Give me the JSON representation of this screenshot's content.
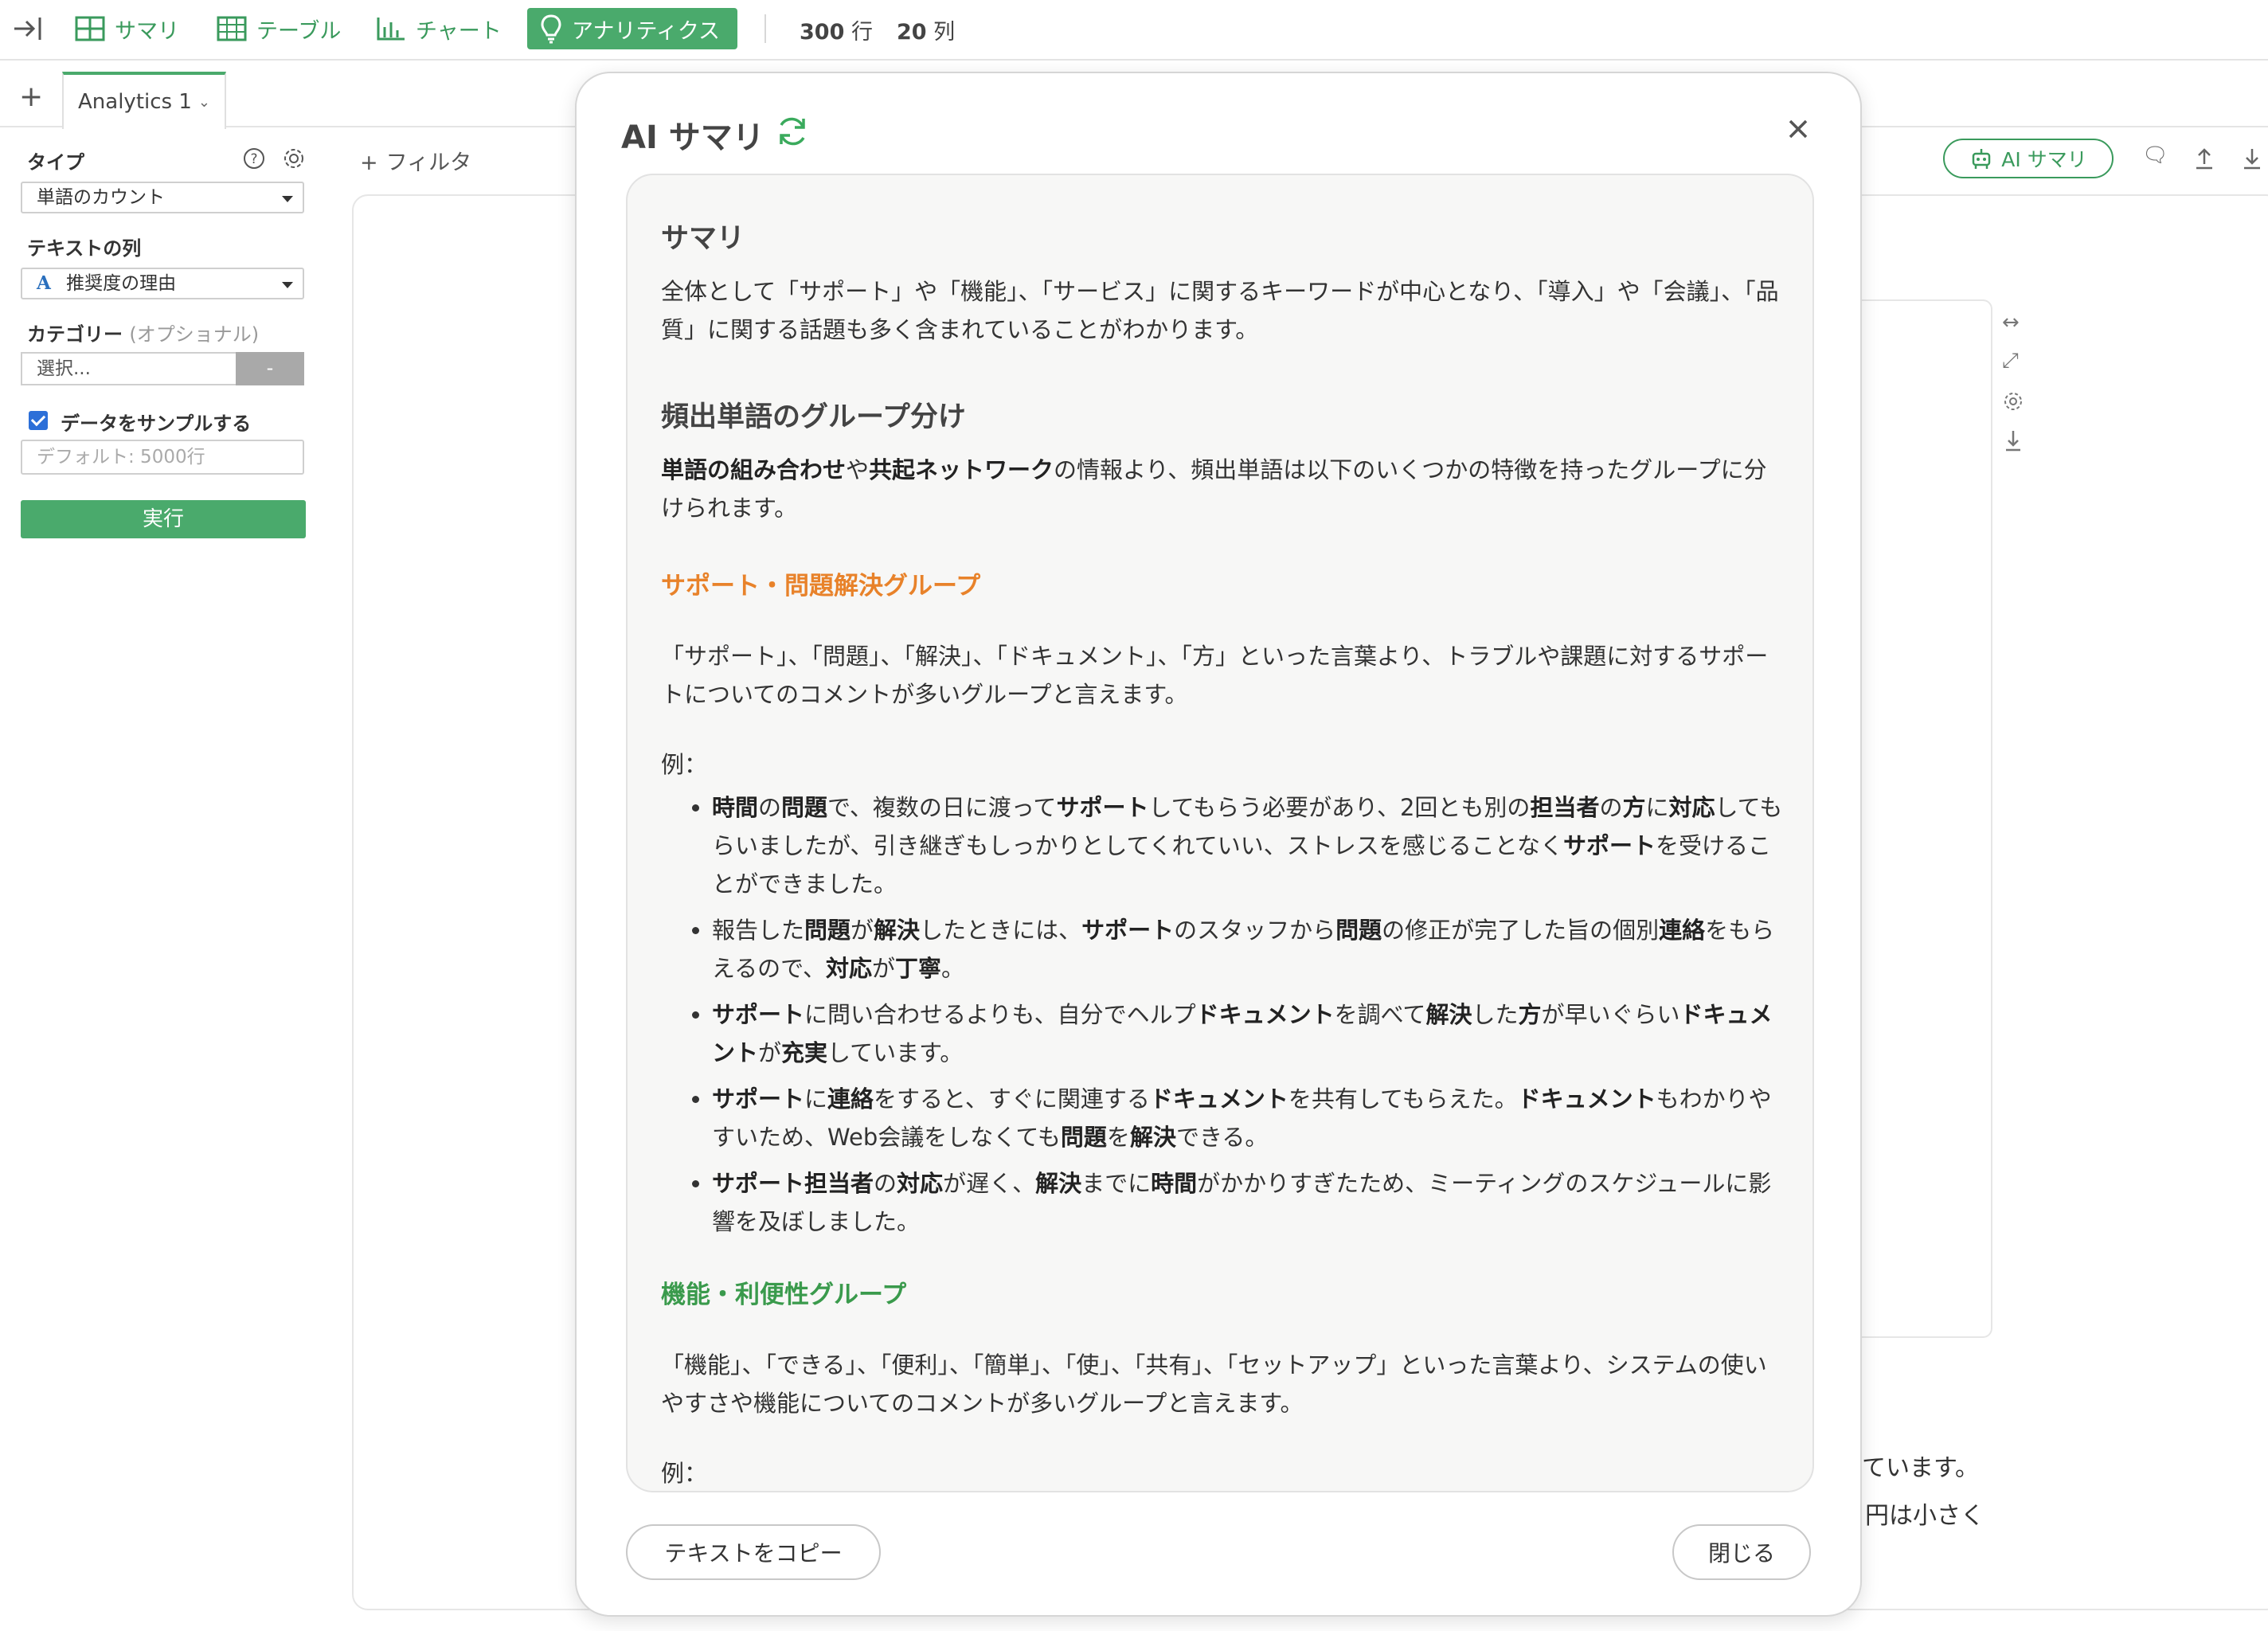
{
  "toolbar": {
    "nav": [
      {
        "label": "サマリ",
        "icon": "grid-icon"
      },
      {
        "label": "テーブル",
        "icon": "table-icon"
      },
      {
        "label": "チャート",
        "icon": "bar-chart-icon"
      },
      {
        "label": "アナリティクス",
        "icon": "lightbulb-icon",
        "active": true
      }
    ],
    "rows_num": "300",
    "rows_unit": "行",
    "cols_num": "20",
    "cols_unit": "列"
  },
  "tabs": [
    {
      "label": "Analytics 1"
    }
  ],
  "left_panel": {
    "type_label": "タイプ",
    "type_value": "単語のカウント",
    "text_col_label": "テキストの列",
    "text_col_value": "推奨度の理由",
    "text_col_type_icon": "A",
    "category_label": "カテゴリー",
    "category_optional": "(オプショナル)",
    "category_placeholder": "選択...",
    "category_btn": "-",
    "sample_label": "データをサンプルする",
    "sample_checked": true,
    "sample_placeholder": "デフォルト: 5000行",
    "run_label": "実行"
  },
  "main": {
    "filter_label": "フィルタ",
    "ai_button_label": "AI サマリ",
    "behind_text_1": "ています。",
    "behind_text_2": "円は小さく"
  },
  "modal": {
    "title": "AI サマリ",
    "summary_heading": "サマリ",
    "summary_text": "全体として「サポート」や「機能」、「サービス」に関するキーワードが中心となり、「導入」や「会議」、「品質」に関する話題も多く含まれていることがわかります。",
    "grouping_heading": "頻出単語のグループ分け",
    "grouping_intro_b1": "単語の組み合わせ",
    "grouping_intro_t1": "や",
    "grouping_intro_b2": "共起ネットワーク",
    "grouping_intro_t2": "の情報より、頻出単語は以下のいくつかの特徴を持ったグループに分けられます。",
    "group1_title": "サポート・問題解決グループ",
    "group1_desc": "「サポート」、「問題」、「解決」、「ドキュメント」、「方」といった言葉より、トラブルや課題に対するサポートについてのコメントが多いグループと言えます。",
    "examples_label": "例：",
    "group1_examples": [
      [
        {
          "t": "時間",
          "b": true
        },
        {
          "t": "の"
        },
        {
          "t": "問題",
          "b": true
        },
        {
          "t": "で、複数の日に渡って"
        },
        {
          "t": "サポート",
          "b": true
        },
        {
          "t": "してもらう必要があり、2回とも別の"
        },
        {
          "t": "担当者",
          "b": true
        },
        {
          "t": "の"
        },
        {
          "t": "方",
          "b": true
        },
        {
          "t": "に"
        },
        {
          "t": "対応",
          "b": true
        },
        {
          "t": "してもらいましたが、引き継ぎもしっかりとしてくれていい、ストレスを感じることなく"
        },
        {
          "t": "サポート",
          "b": true
        },
        {
          "t": "を受けることができました。"
        }
      ],
      [
        {
          "t": "報告した"
        },
        {
          "t": "問題",
          "b": true
        },
        {
          "t": "が"
        },
        {
          "t": "解決",
          "b": true
        },
        {
          "t": "したときには、"
        },
        {
          "t": "サポート",
          "b": true
        },
        {
          "t": "のスタッフから"
        },
        {
          "t": "問題",
          "b": true
        },
        {
          "t": "の修正が完了した旨の個別"
        },
        {
          "t": "連絡",
          "b": true
        },
        {
          "t": "をもらえるので、"
        },
        {
          "t": "対応",
          "b": true
        },
        {
          "t": "が"
        },
        {
          "t": "丁寧",
          "b": true
        },
        {
          "t": "。"
        }
      ],
      [
        {
          "t": "サポート",
          "b": true
        },
        {
          "t": "に問い合わせるよりも、自分でヘルプ"
        },
        {
          "t": "ドキュメント",
          "b": true
        },
        {
          "t": "を調べて"
        },
        {
          "t": "解決",
          "b": true
        },
        {
          "t": "した"
        },
        {
          "t": "方",
          "b": true
        },
        {
          "t": "が早いぐらい"
        },
        {
          "t": "ドキュメント",
          "b": true
        },
        {
          "t": "が"
        },
        {
          "t": "充実",
          "b": true
        },
        {
          "t": "しています。"
        }
      ],
      [
        {
          "t": "サポート",
          "b": true
        },
        {
          "t": "に"
        },
        {
          "t": "連絡",
          "b": true
        },
        {
          "t": "をすると、すぐに関連する"
        },
        {
          "t": "ドキュメント",
          "b": true
        },
        {
          "t": "を共有してもらえた。"
        },
        {
          "t": "ドキュメント",
          "b": true
        },
        {
          "t": "もわかりやすいため、Web会議をしなくても"
        },
        {
          "t": "問題",
          "b": true
        },
        {
          "t": "を"
        },
        {
          "t": "解決",
          "b": true
        },
        {
          "t": "できる。"
        }
      ],
      [
        {
          "t": "サポート",
          "b": true
        },
        {
          "t": "担当者",
          "b": true
        },
        {
          "t": "の"
        },
        {
          "t": "対応",
          "b": true
        },
        {
          "t": "が遅く、"
        },
        {
          "t": "解決",
          "b": true
        },
        {
          "t": "までに"
        },
        {
          "t": "時間",
          "b": true
        },
        {
          "t": "がかかりすぎたため、ミーティングのスケジュールに影響を及ぼしました。"
        }
      ]
    ],
    "group2_title": "機能・利便性グループ",
    "group2_desc": "「機能」、「できる」、「便利」、「簡単」、「使」、「共有」、「セットアップ」といった言葉より、システムの使いやすさや機能についてのコメントが多いグループと言えます。",
    "copy_btn": "テキストをコピー",
    "close_btn": "閉じる"
  },
  "colors": {
    "accent_green": "#4aaa6c",
    "group1_orange": "#e8822a",
    "group2_green": "#3a9a4c",
    "checkbox_blue": "#2c6fd8"
  }
}
